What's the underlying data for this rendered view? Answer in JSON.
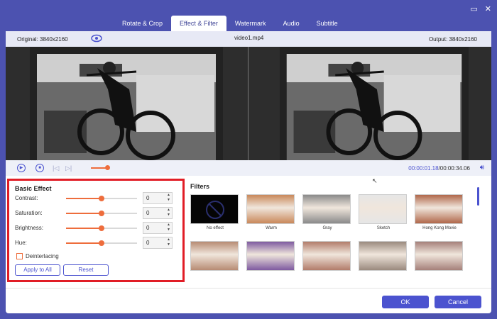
{
  "window": {
    "minimize_icon": "▭",
    "close_icon": "✕"
  },
  "tabs": [
    {
      "label": "Rotate & Crop",
      "active": false
    },
    {
      "label": "Effect & Filter",
      "active": true
    },
    {
      "label": "Watermark",
      "active": false
    },
    {
      "label": "Audio",
      "active": false
    },
    {
      "label": "Subtitle",
      "active": false
    }
  ],
  "preview": {
    "original_label": "Original: 3840x2160",
    "file_name": "video1.mp4",
    "output_label": "Output: 3840x2160",
    "current_time": "00:00:01.18",
    "total_time": "/00:00:34.06",
    "volume_level": 0.85
  },
  "basic_effect": {
    "title": "Basic Effect",
    "rows": [
      {
        "label": "Contrast:",
        "value": "0",
        "level": 0.5
      },
      {
        "label": "Saturation:",
        "value": "0",
        "level": 0.5
      },
      {
        "label": "Brightness:",
        "value": "0",
        "level": 0.5
      },
      {
        "label": "Hue:",
        "value": "0",
        "level": 0.5
      }
    ],
    "deinterlacing_label": "Deinterlacing",
    "deinterlacing_checked": false,
    "apply_all_label": "Apply to All",
    "reset_label": "Reset"
  },
  "filters": {
    "title": "Filters",
    "items": [
      {
        "label": "No effect",
        "tone": "#111111"
      },
      {
        "label": "Warm",
        "tone": "#c9885a"
      },
      {
        "label": "Gray",
        "tone": "#8a8a8a"
      },
      {
        "label": "Sketch",
        "tone": "#e6e6e6"
      },
      {
        "label": "Hong Kong Movie",
        "tone": "#b0674a"
      },
      {
        "label": "",
        "tone": "#b78b73"
      },
      {
        "label": "",
        "tone": "#7e5aa0"
      },
      {
        "label": "",
        "tone": "#b27c6a"
      },
      {
        "label": "",
        "tone": "#9a8a7e"
      },
      {
        "label": "",
        "tone": "#a5807a"
      }
    ]
  },
  "footer": {
    "ok_label": "OK",
    "cancel_label": "Cancel"
  },
  "colors": {
    "accent": "#4b53cf",
    "slider": "#ee6d3c",
    "highlight": "#e11d26"
  }
}
